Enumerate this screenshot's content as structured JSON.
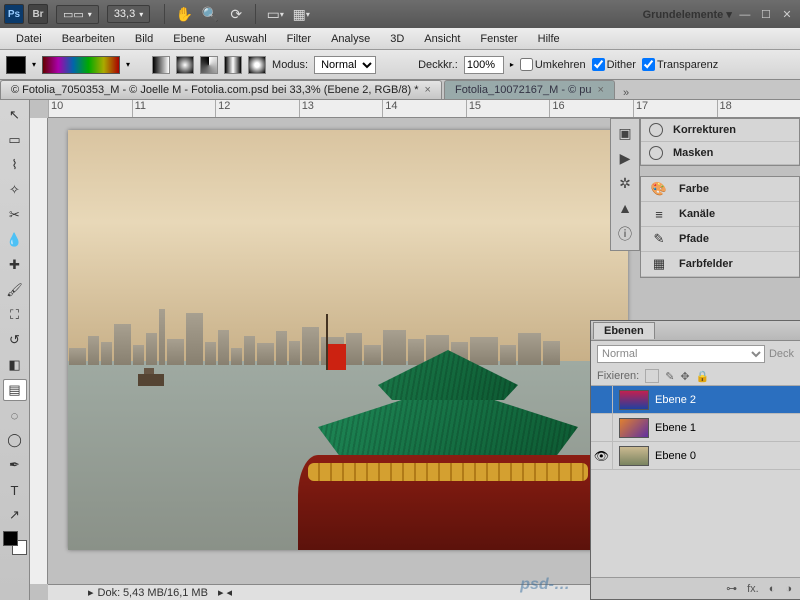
{
  "appbar": {
    "zoom": "33,3",
    "workspace": "Grundelemente"
  },
  "menu": [
    "Datei",
    "Bearbeiten",
    "Bild",
    "Ebene",
    "Auswahl",
    "Filter",
    "Analyse",
    "3D",
    "Ansicht",
    "Fenster",
    "Hilfe"
  ],
  "options": {
    "modus_label": "Modus:",
    "modus_value": "Normal",
    "opacity_label": "Deckkr.:",
    "opacity_value": "100%",
    "cb_umkehren": "Umkehren",
    "cb_dither": "Dither",
    "cb_transparenz": "Transparenz"
  },
  "tabs": [
    {
      "title": "© Fotolia_7050353_M - © Joelle M - Fotolia.com.psd bei 33,3% (Ebene 2, RGB/8) *",
      "active": true
    },
    {
      "title": "Fotolia_10072167_M - © pu",
      "active": false
    }
  ],
  "ruler_marks": [
    "10",
    "11",
    "12",
    "13",
    "14",
    "15",
    "16",
    "17",
    "18"
  ],
  "status": {
    "doc_label": "Dok:",
    "doc_value": "5,43 MB/16,1 MB"
  },
  "right_panels": [
    {
      "icon": "◐",
      "label": "Korrekturen"
    },
    {
      "icon": "◉",
      "label": "Masken"
    },
    {
      "icon": "🎨",
      "label": "Farbe"
    },
    {
      "icon": "≡",
      "label": "Kanäle"
    },
    {
      "icon": "✎",
      "label": "Pfade"
    },
    {
      "icon": "▦",
      "label": "Farbfelder"
    }
  ],
  "iconcol": [
    "▣",
    "▶",
    "✲",
    "▲",
    "ⓘ"
  ],
  "layers_panel": {
    "tab": "Ebenen",
    "mode": "Normal",
    "opacity_lbl": "Deck",
    "lock_label": "Fixieren:",
    "layers": [
      {
        "name": "Ebene 2",
        "sel": true,
        "eye": "",
        "grad": "linear-gradient(#c22050,#2040a0)"
      },
      {
        "name": "Ebene 1",
        "sel": false,
        "eye": "",
        "grad": "linear-gradient(135deg,#e08030,#6030a0)"
      },
      {
        "name": "Ebene 0",
        "sel": false,
        "eye": "👁",
        "grad": "linear-gradient(#cbb990,#7a8460)"
      }
    ]
  },
  "watermark": "psd-…"
}
